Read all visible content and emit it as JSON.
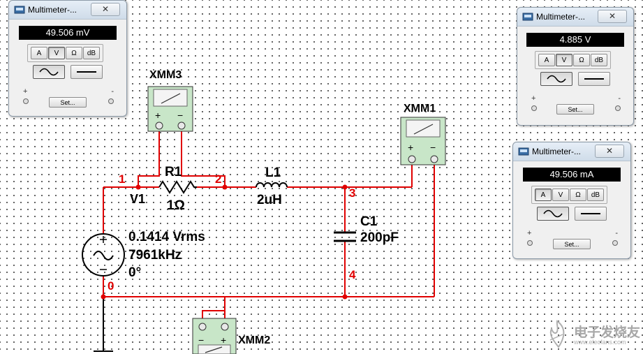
{
  "colors": {
    "wire": "#e00000",
    "node_label": "#e00000",
    "component": "#000000",
    "instrument_fill": "#c8e6c8",
    "meter_display_bg": "#000000",
    "meter_display_fg": "#ffffff",
    "dot_grid": "#3c3c3c"
  },
  "source": {
    "name": "V1",
    "amplitude": "0.1414 Vrms",
    "frequency": "7961kHz",
    "phase": "0°"
  },
  "components": {
    "r1": {
      "name": "R1",
      "value": "1Ω"
    },
    "l1": {
      "name": "L1",
      "value": "2uH"
    },
    "c1": {
      "name": "C1",
      "value": "200pF"
    }
  },
  "nodes": [
    "1",
    "2",
    "3",
    "4",
    "0"
  ],
  "instruments": {
    "xmm1": {
      "name": "XMM1"
    },
    "xmm2": {
      "name": "XMM2"
    },
    "xmm3": {
      "name": "XMM3"
    }
  },
  "meter_panels": [
    {
      "title": "Multimeter-...",
      "close_icon": "close-x-icon",
      "reading": "49.506 mV",
      "mode_buttons": [
        "A",
        "V",
        "Ω",
        "dB"
      ],
      "active_mode": "V",
      "active_wave": "ac",
      "terminal_plus": "+",
      "terminal_minus": "-",
      "set_label": "Set..."
    },
    {
      "title": "Multimeter-...",
      "close_icon": "close-x-icon",
      "reading": "4.885 V",
      "mode_buttons": [
        "A",
        "V",
        "Ω",
        "dB"
      ],
      "active_mode": "V",
      "active_wave": "ac",
      "terminal_plus": "+",
      "terminal_minus": "-",
      "set_label": "Set..."
    },
    {
      "title": "Multimeter-...",
      "close_icon": "close-x-icon",
      "reading": "49.506 mA",
      "mode_buttons": [
        "A",
        "V",
        "Ω",
        "dB"
      ],
      "active_mode": "A",
      "active_wave": "ac",
      "terminal_plus": "+",
      "terminal_minus": "-",
      "set_label": "Set..."
    }
  ],
  "watermark": {
    "name": "电子发烧友",
    "site": "www.elecfans.com",
    "icon": "elecfans-logo-icon"
  }
}
